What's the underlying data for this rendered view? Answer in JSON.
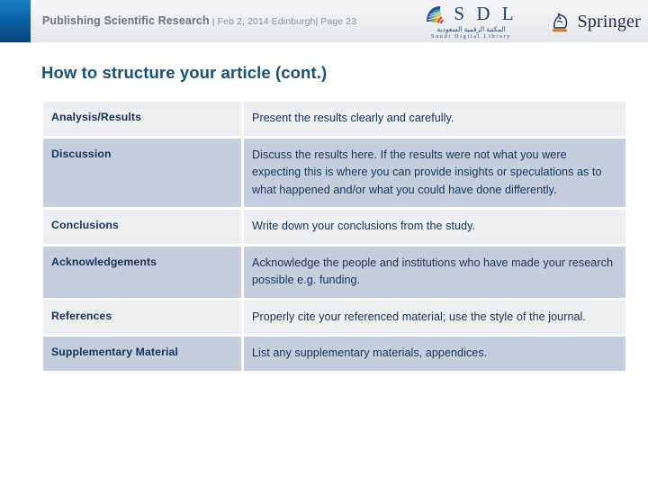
{
  "header": {
    "title": "Publishing Scientific Research",
    "meta": " | Feb 2, 2014 Edinburgh| Page 23",
    "accent_color": "#0a5490"
  },
  "logos": {
    "sdl": {
      "letters": "S D L",
      "arabic": "المكتبة الرقمية السعودية",
      "subtitle": "Saudi Digital Library",
      "mark_name": "sdl-fan-mark",
      "color": "#1f3f73"
    },
    "springer": {
      "wordmark": "Springer",
      "mark_name": "springer-knight-icon",
      "color": "#1b2a44",
      "accent_color": "#c8732f"
    }
  },
  "slide": {
    "title": "How to structure your article (cont.)",
    "title_color": "#16507f"
  },
  "table": {
    "row_colors": {
      "light": "#eceef0",
      "dark": "#c6cedd"
    },
    "rows": [
      {
        "label": "Analysis/Results",
        "description": "Present the results clearly and carefully."
      },
      {
        "label": "Discussion",
        "description": "Discuss the results here. If the results were not what you were expecting this is where you can provide insights or speculations as to what happened and/or what you could have done differently."
      },
      {
        "label": "Conclusions",
        "description": "Write down your conclusions from the study."
      },
      {
        "label": "Acknowledgements",
        "description": "Acknowledge the people and institutions who have made your research possible e.g. funding."
      },
      {
        "label": "References",
        "description": "Properly cite your referenced material; use the style of the journal."
      },
      {
        "label": "Supplementary Material",
        "description": "List any supplementary materials, appendices."
      }
    ]
  }
}
